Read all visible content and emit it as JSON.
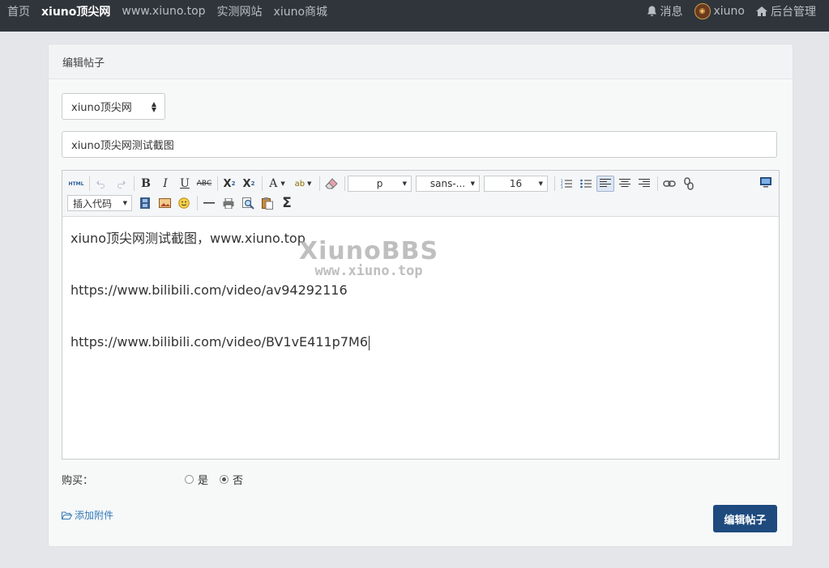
{
  "nav": {
    "left": [
      {
        "label": "首页",
        "active": false
      },
      {
        "label": "xiuno顶尖网",
        "active": true
      },
      {
        "label": "www.xiuno.top",
        "active": false
      },
      {
        "label": "实测网站",
        "active": false
      },
      {
        "label": "xiuno商城",
        "active": false
      }
    ],
    "messages": "消息",
    "user": "xiuno",
    "admin": "后台管理"
  },
  "card": {
    "header": "编辑帖子",
    "forum_select": "xiuno顶尖网",
    "title_value": "xiuno顶尖网测试截图"
  },
  "toolbar": {
    "html_label": "HTML",
    "paragraph_combo": "p",
    "font_combo": "sans-...",
    "size_combo": "16",
    "code_combo": "插入代码"
  },
  "editor": {
    "line1": "xiuno顶尖网测试截图，www.xiuno.top",
    "line2": "https://www.bilibili.com/video/av94292116",
    "line3": "https://www.bilibili.com/video/BV1vE411p7M6",
    "watermark_1": "XiunoBBS",
    "watermark_2": "www.xiuno.top"
  },
  "form": {
    "buy_label": "购买：",
    "yes_label": "是",
    "no_label": "否",
    "selected": "no",
    "attach_label": "添加附件",
    "submit_label": "编辑帖子"
  },
  "colors": {
    "navbar": "#2f353b",
    "primary": "#1e4a7e",
    "link": "#337ab7"
  }
}
